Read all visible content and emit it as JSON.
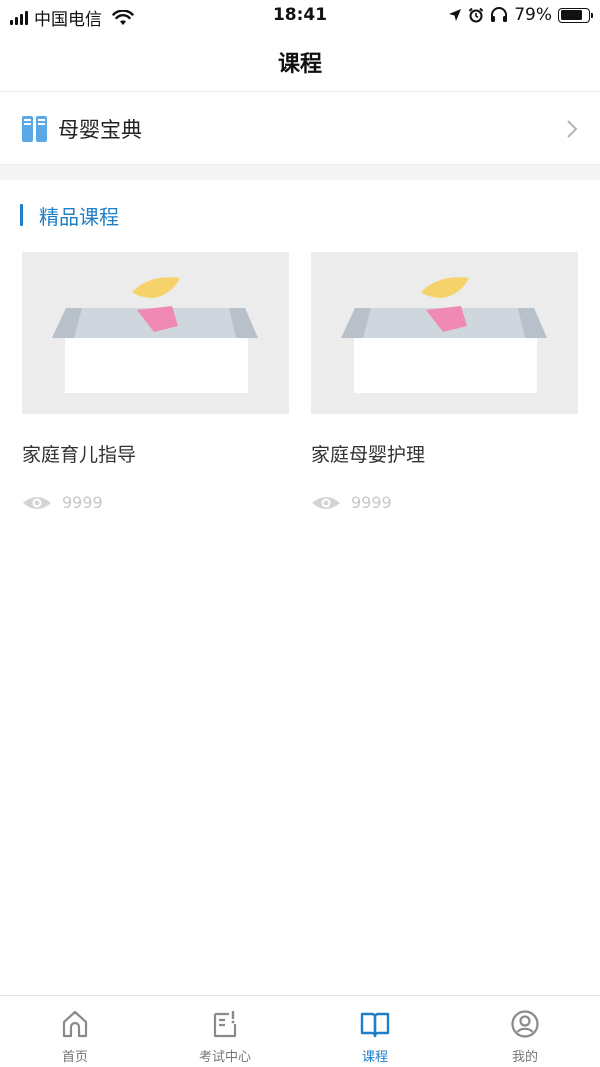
{
  "status_bar": {
    "carrier": "中国电信",
    "time": "18:41",
    "battery_percent": "79%",
    "battery_level": 0.79
  },
  "nav": {
    "title": "课程"
  },
  "baodian": {
    "label": "母婴宝典",
    "icon": "book-pair-icon"
  },
  "section": {
    "title": "精品课程",
    "accent_color": "#1f7fc6"
  },
  "courses": [
    {
      "title": "家庭育儿指导",
      "views": "9999"
    },
    {
      "title": "家庭母婴护理",
      "views": "9999"
    }
  ],
  "tabs": [
    {
      "label": "首页",
      "icon": "home-icon",
      "active": false
    },
    {
      "label": "考试中心",
      "icon": "exam-icon",
      "active": false
    },
    {
      "label": "课程",
      "icon": "course-book-icon",
      "active": true
    },
    {
      "label": "我的",
      "icon": "profile-icon",
      "active": false
    }
  ]
}
